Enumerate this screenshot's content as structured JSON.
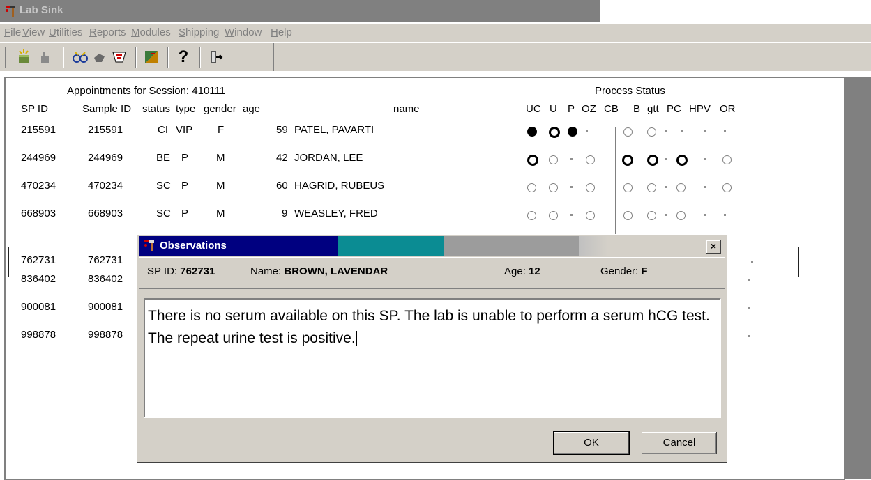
{
  "window": {
    "title": "Lab Sink"
  },
  "menu": [
    "File",
    "View",
    "Utilities",
    "Reports",
    "Modules",
    "Shipping",
    "Window",
    "Help"
  ],
  "toolbar": {
    "icons": [
      "new-icon",
      "hand-icon",
      "glasses-icon",
      "pointer-icon",
      "checklist-icon",
      "transfer-icon",
      "help-icon",
      "exit-icon"
    ]
  },
  "appointments": {
    "title": "Appointments for Session: 410111",
    "process_status_title": "Process Status",
    "columns": {
      "sp_id": "SP ID",
      "sample_id": "Sample ID",
      "status": "status",
      "type": "type",
      "gender": "gender",
      "age": "age",
      "name": "name"
    },
    "process_columns": [
      "UC",
      "U",
      "P",
      "OZ",
      "CB",
      "B",
      "gtt",
      "PC",
      "HPV",
      "OR"
    ],
    "rows": [
      {
        "sp_id": "215591",
        "sample_id": "215591",
        "status": "CI",
        "type": "VIP",
        "gender": "F",
        "age": "59",
        "name": "PATEL, PAVARTI"
      },
      {
        "sp_id": "244969",
        "sample_id": "244969",
        "status": "BE",
        "type": "P",
        "gender": "M",
        "age": "42",
        "name": "JORDAN, LEE"
      },
      {
        "sp_id": "470234",
        "sample_id": "470234",
        "status": "SC",
        "type": "P",
        "gender": "M",
        "age": "60",
        "name": "HAGRID, RUBEUS"
      },
      {
        "sp_id": "668903",
        "sample_id": "668903",
        "status": "SC",
        "type": "P",
        "gender": "M",
        "age": "9",
        "name": "WEASLEY, FRED"
      },
      {
        "sp_id": "762731",
        "sample_id": "762731"
      },
      {
        "sp_id": "836402",
        "sample_id": "836402"
      },
      {
        "sp_id": "900081",
        "sample_id": "900081"
      },
      {
        "sp_id": "998878",
        "sample_id": "998878"
      }
    ]
  },
  "dialog": {
    "title": "Observations",
    "close_glyph": "×",
    "sp_id_label": "SP ID:",
    "sp_id": "762731",
    "name_label": "Name:",
    "name": "BROWN, LAVENDAR",
    "age_label": "Age:",
    "age": "12",
    "gender_label": "Gender:",
    "gender": "F",
    "text": "There is no serum available on this SP. The lab is unable to perform a serum hCG test. The repeat urine test is positive.",
    "ok_label": "OK",
    "cancel_label": "Cancel"
  }
}
